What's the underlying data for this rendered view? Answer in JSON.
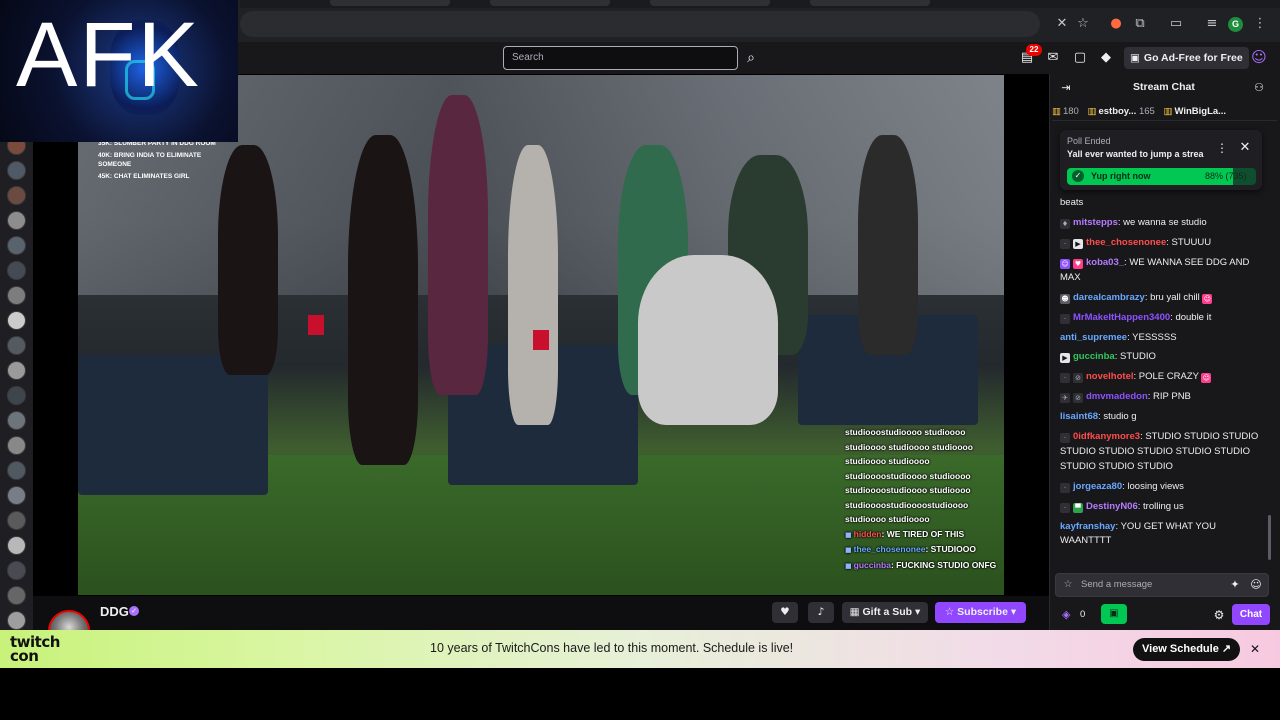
{
  "webcam": {
    "overlay_text": "AFK"
  },
  "topnav": {
    "search_placeholder": "Search",
    "notification_count": "22",
    "ad_free_label": "Go Ad-Free for Free"
  },
  "video": {
    "goals": [
      "35k: slumber party in ddg room",
      "40k: bring india to eliminate someone",
      "45k: chat eliminates girl"
    ],
    "onscreen_chat": {
      "spam_lines": [
        "studiooostudioooo studioooo",
        "studioooo studioooo studioooo",
        "studioooo studioooo",
        "studioooostudioooo studioooo",
        "studioooostudioooo studioooo",
        "studioooostudioooostudioooo",
        "studioooo studioooo"
      ],
      "messages": [
        {
          "user": "hidden",
          "text": "WE TIRED OF THIS"
        },
        {
          "user": "thee_chosenonee",
          "text": "STUDIOOO"
        },
        {
          "user": "guccinba",
          "text": "FUCKING STUDIO ONFG"
        }
      ]
    }
  },
  "stream": {
    "streamer_name": "DDG",
    "gift_sub_label": "Gift a Sub",
    "subscribe_label": "Subscribe"
  },
  "chat": {
    "header_title": "Stream Chat",
    "leaderboard": [
      {
        "rank_user": "",
        "count": "180"
      },
      {
        "rank_user": "estboy...",
        "count": "165"
      },
      {
        "rank_user": "WinBigLa...",
        "count": ""
      }
    ],
    "poll": {
      "status": "Poll Ended",
      "question": "Yall ever wanted to jump a strea",
      "option": "Yup right now",
      "result": "88% (735)",
      "fraction": 0.88
    },
    "messages": [
      {
        "user": "",
        "text": "beats"
      },
      {
        "user": "mitstepps",
        "text": "we wanna se studio"
      },
      {
        "user": "thee_chosenonee",
        "text": "STUUUU"
      },
      {
        "user": "koba03_",
        "text": "WE WANNA SEE DDG AND MAX"
      },
      {
        "user": "darealcambrazy",
        "text": "bru yall chill"
      },
      {
        "user": "MrMakeItHappen3400",
        "text": "double it"
      },
      {
        "user": "anti_supremee",
        "text": "YESSSSS"
      },
      {
        "user": "guccinba",
        "text": "STUDIO"
      },
      {
        "user": "novelhotel",
        "text": "POLE CRAZY"
      },
      {
        "user": "dmvmadedon",
        "text": "RIP PNB"
      },
      {
        "user": "lisaint68",
        "text": "studio g"
      },
      {
        "user": "0idfkanymore3",
        "text": "STUDIO STUDIO STUDIO STUDIO STUDIO STUDIO STUDIO STUDIO STUDIO STUDIO STUDIO"
      },
      {
        "user": "jorgeaza80",
        "text": "loosing views"
      },
      {
        "user": "DestinyN06",
        "text": "trolling us"
      },
      {
        "user": "kayfranshay",
        "text": "YOU GET WHAT YOU WAANTTTT"
      }
    ],
    "input_placeholder": "Send a message",
    "points": "0",
    "send_label": "Chat"
  },
  "banner": {
    "logo": "twitch con",
    "text": "10 years of TwitchCons have led to this moment. Schedule is live!",
    "button_label": "View Schedule ↗"
  },
  "colors": {
    "accent": "#9147ff",
    "poll_green": "#00c853",
    "chat_bg": "#18181b",
    "banner_start": "#c8f27a",
    "banner_end": "#f7c9e0"
  }
}
